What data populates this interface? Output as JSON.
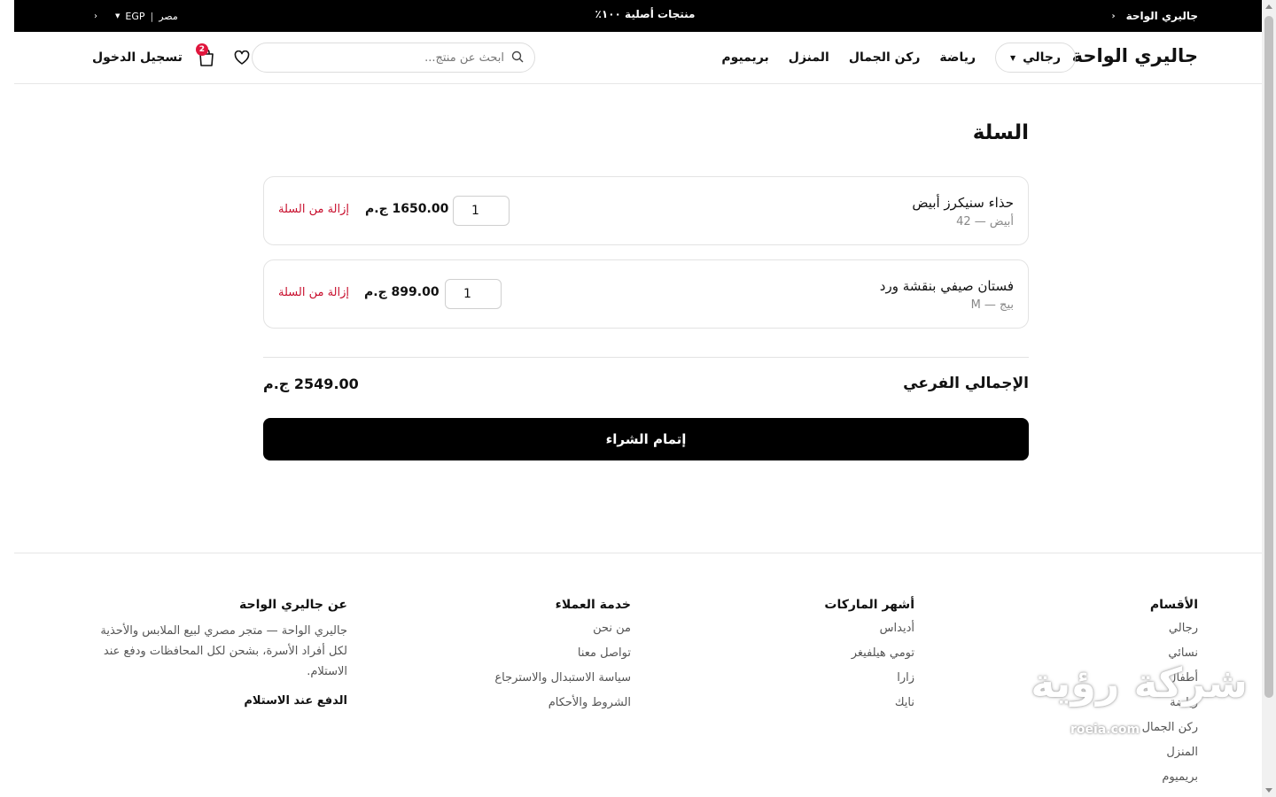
{
  "topbar": {
    "brand": "جاليري الواحة",
    "announcement": "منتجات أصلية ١٠٠٪",
    "country": "مصر",
    "currency": "EGP",
    "separator": "|"
  },
  "header": {
    "logo": "جاليري الواحة",
    "nav": {
      "dropdown_label": "رجالي",
      "items": [
        "رياضة",
        "ركن الجمال",
        "المنزل",
        "بريميوم"
      ]
    },
    "search": {
      "placeholder": "ابحث عن منتج..."
    },
    "cart_count": "2",
    "login_label": "تسجيل الدخول"
  },
  "cart": {
    "title": "السلة",
    "items": [
      {
        "name": "حذاء سنيكرز أبيض",
        "variant": "أبيض — 42",
        "quantity": "1",
        "price": "1650.00 ج.م",
        "remove_label": "إزالة من السلة"
      },
      {
        "name": "فستان صيفي بنقشة ورد",
        "variant": "بيج — M",
        "quantity": "1",
        "price": "899.00 ج.م",
        "remove_label": "إزالة من السلة"
      }
    ],
    "subtotal_label": "الإجمالي الفرعي",
    "subtotal_value": "2549.00 ج.م",
    "checkout_label": "إتمام الشراء"
  },
  "footer": {
    "categories": {
      "heading": "الأقسام",
      "links": [
        "رجالي",
        "نسائي",
        "أطفال",
        "رياضة",
        "ركن الجمال",
        "المنزل",
        "بريميوم"
      ]
    },
    "brands": {
      "heading": "أشهر الماركات",
      "links": [
        "أديداس",
        "تومي هيلفيغر",
        "زارا",
        "نايك"
      ]
    },
    "service": {
      "heading": "خدمة العملاء",
      "links": [
        "من نحن",
        "تواصل معنا",
        "سياسة الاستبدال والاسترجاع",
        "الشروط والأحكام"
      ]
    },
    "about": {
      "heading": "عن جاليري الواحة",
      "text": "جاليري الواحة — متجر مصري لبيع الملابس والأحذية لكل أفراد الأسرة، بشحن لكل المحافظات ودفع عند الاستلام.",
      "cod": "الدفع عند الاستلام"
    }
  },
  "watermark": {
    "text": "شركة رؤية",
    "url": "roeia.com"
  }
}
